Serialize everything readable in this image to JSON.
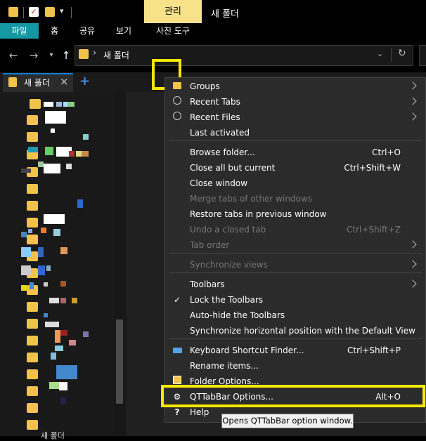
{
  "window": {
    "title": "새 폴더",
    "contextual_tab": "관리",
    "ribbon_tabs": [
      "파일",
      "홈",
      "공유",
      "보기",
      "사진 도구"
    ]
  },
  "address_bar": {
    "path": "새 폴더",
    "separator": "›"
  },
  "tabs": {
    "active_tab": "새 폴더",
    "close_glyph": "×",
    "add_glyph": "+"
  },
  "tree": {
    "bottom_item_label": "새 폴더"
  },
  "context_menu": {
    "items": [
      {
        "label": "Groups",
        "shortcut": "",
        "submenu": true,
        "disabled": false,
        "icon": "folder-icon"
      },
      {
        "label": "Recent Tabs",
        "shortcut": "",
        "submenu": true,
        "disabled": false,
        "icon": "clock-icon"
      },
      {
        "label": "Recent Files",
        "shortcut": "",
        "submenu": true,
        "disabled": false,
        "icon": "clock-icon"
      },
      {
        "label": "Last activated",
        "shortcut": "",
        "submenu": false,
        "disabled": false,
        "icon": ""
      },
      {
        "label": "Browse folder...",
        "shortcut": "Ctrl+O",
        "submenu": false,
        "disabled": false,
        "icon": ""
      },
      {
        "label": "Close all but current",
        "shortcut": "Ctrl+Shift+W",
        "submenu": false,
        "disabled": false,
        "icon": ""
      },
      {
        "label": "Close window",
        "shortcut": "",
        "submenu": false,
        "disabled": false,
        "icon": ""
      },
      {
        "label": "Merge tabs of other windows",
        "shortcut": "",
        "submenu": false,
        "disabled": true,
        "icon": ""
      },
      {
        "label": "Restore tabs in previous window",
        "shortcut": "",
        "submenu": false,
        "disabled": false,
        "icon": ""
      },
      {
        "label": "Undo a closed tab",
        "shortcut": "Ctrl+Shift+Z",
        "submenu": false,
        "disabled": true,
        "icon": ""
      },
      {
        "label": "Tab order",
        "shortcut": "",
        "submenu": true,
        "disabled": true,
        "icon": ""
      },
      {
        "label": "Synchronize views",
        "shortcut": "",
        "submenu": true,
        "disabled": true,
        "icon": ""
      },
      {
        "label": "Toolbars",
        "shortcut": "",
        "submenu": true,
        "disabled": false,
        "icon": ""
      },
      {
        "label": "Lock the Toolbars",
        "shortcut": "",
        "submenu": false,
        "disabled": false,
        "icon": "checkmark-icon"
      },
      {
        "label": "Auto-hide the Toolbars",
        "shortcut": "",
        "submenu": false,
        "disabled": false,
        "icon": ""
      },
      {
        "label": "Synchronize horizontal position with the Default View",
        "shortcut": "",
        "submenu": false,
        "disabled": false,
        "icon": ""
      },
      {
        "label": "Keyboard Shortcut Finder...",
        "shortcut": "Ctrl+Shift+P",
        "submenu": false,
        "disabled": false,
        "icon": "keyboard-icon"
      },
      {
        "label": "Rename items...",
        "shortcut": "",
        "submenu": false,
        "disabled": false,
        "icon": ""
      },
      {
        "label": "Folder Options...",
        "shortcut": "",
        "submenu": false,
        "disabled": false,
        "icon": "folder-options-icon"
      },
      {
        "label": "QTTabBar Options...",
        "shortcut": "Alt+O",
        "submenu": false,
        "disabled": false,
        "icon": "gear-icon"
      },
      {
        "label": "Help",
        "shortcut": "",
        "submenu": false,
        "disabled": false,
        "icon": "help-icon"
      }
    ]
  },
  "tooltip": {
    "text": "Opens QTTabBar option window."
  },
  "colors": {
    "highlight": "#f7e800",
    "contextual_tab_bg": "#f7e28a",
    "file_tab_bg": "#1698a4",
    "menu_bg": "#2b2b2b"
  }
}
